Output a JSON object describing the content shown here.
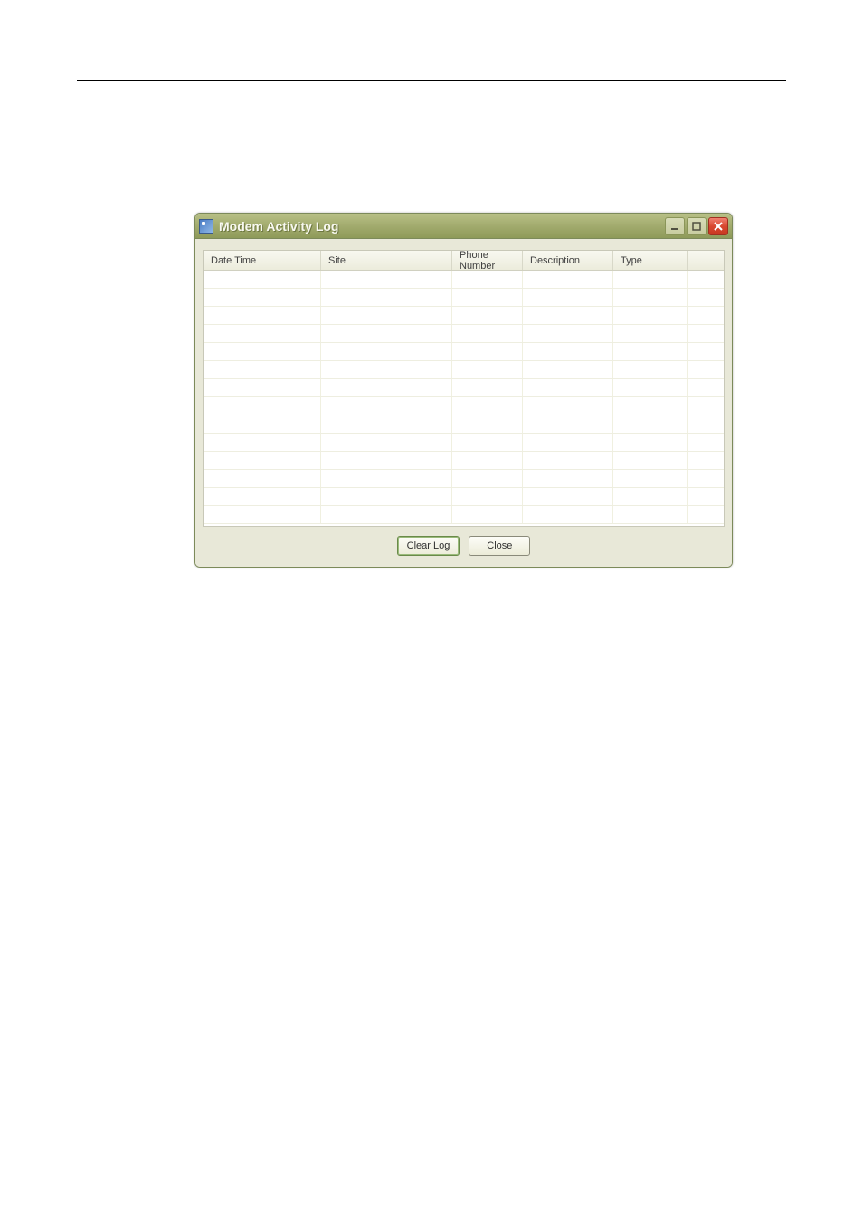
{
  "window": {
    "title": "Modem Activity Log"
  },
  "table": {
    "columns": {
      "datetime": "Date Time",
      "site": "Site",
      "phone": "Phone Number",
      "description": "Description",
      "type": "Type"
    },
    "rows": [
      {
        "datetime": "",
        "site": "",
        "phone": "",
        "description": "",
        "type": ""
      },
      {
        "datetime": "",
        "site": "",
        "phone": "",
        "description": "",
        "type": ""
      },
      {
        "datetime": "",
        "site": "",
        "phone": "",
        "description": "",
        "type": ""
      },
      {
        "datetime": "",
        "site": "",
        "phone": "",
        "description": "",
        "type": ""
      },
      {
        "datetime": "",
        "site": "",
        "phone": "",
        "description": "",
        "type": ""
      },
      {
        "datetime": "",
        "site": "",
        "phone": "",
        "description": "",
        "type": ""
      },
      {
        "datetime": "",
        "site": "",
        "phone": "",
        "description": "",
        "type": ""
      },
      {
        "datetime": "",
        "site": "",
        "phone": "",
        "description": "",
        "type": ""
      },
      {
        "datetime": "",
        "site": "",
        "phone": "",
        "description": "",
        "type": ""
      },
      {
        "datetime": "",
        "site": "",
        "phone": "",
        "description": "",
        "type": ""
      },
      {
        "datetime": "",
        "site": "",
        "phone": "",
        "description": "",
        "type": ""
      },
      {
        "datetime": "",
        "site": "",
        "phone": "",
        "description": "",
        "type": ""
      },
      {
        "datetime": "",
        "site": "",
        "phone": "",
        "description": "",
        "type": ""
      },
      {
        "datetime": "",
        "site": "",
        "phone": "",
        "description": "",
        "type": ""
      }
    ]
  },
  "buttons": {
    "clear": "Clear Log",
    "close": "Close"
  }
}
